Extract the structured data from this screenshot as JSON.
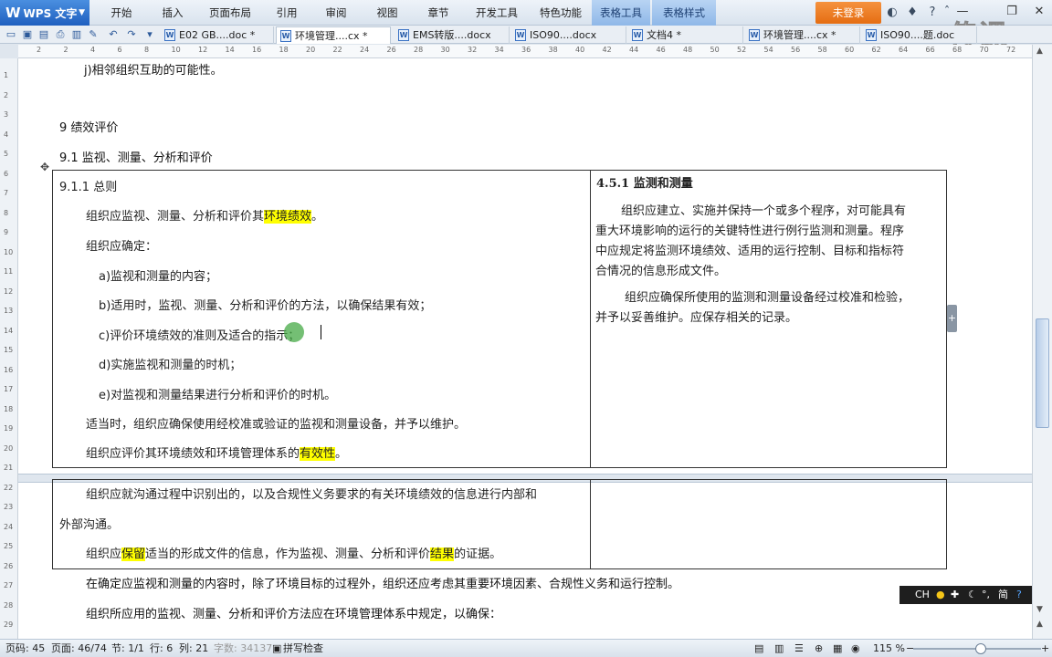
{
  "app": {
    "logo": "WPS 文字"
  },
  "menu": [
    "开始",
    "插入",
    "页面布局",
    "引用",
    "审阅",
    "视图",
    "章节",
    "开发工具",
    "特色功能",
    "表格工具",
    "表格样式"
  ],
  "login": "未登录",
  "watermark": "传课",
  "doc_tabs": [
    {
      "label": "E02 GB....doc *"
    },
    {
      "label": "环境管理....cx *"
    },
    {
      "label": "EMS转版....docx"
    },
    {
      "label": "ISO90....docx"
    },
    {
      "label": "文档4 *"
    },
    {
      "label": "环境管理....cx *"
    },
    {
      "label": "ISO90....题.doc"
    }
  ],
  "hruler_numbers": [
    "2",
    "2",
    "4",
    "6",
    "8",
    "10",
    "12",
    "14",
    "16",
    "18",
    "20",
    "22",
    "24",
    "26",
    "28",
    "30",
    "32",
    "34",
    "36",
    "38",
    "40",
    "42",
    "44",
    "46",
    "48",
    "50",
    "52",
    "54",
    "56",
    "58",
    "60",
    "62",
    "64",
    "66",
    "68",
    "70",
    "72"
  ],
  "vruler_numbers": [
    "1",
    "2",
    "3",
    "4",
    "5",
    "6",
    "7",
    "8",
    "9",
    "10",
    "11",
    "12",
    "13",
    "14",
    "15",
    "16",
    "17",
    "18",
    "19",
    "20",
    "21",
    "22",
    "23",
    "24",
    "25",
    "26",
    "27",
    "28",
    "29"
  ],
  "document": {
    "top_fragment": "j)相邻组织互助的可能性。",
    "heading_9": "9 绩效评价",
    "heading_91": "9.1 监视、测量、分析和评价",
    "left": {
      "h": "9.1.1 总则",
      "p1a": "组织应监视、测量、分析和评价其",
      "p1hl": "环境绩效",
      "p1b": "。",
      "p2": "组织应确定：",
      "a": "a)监视和测量的内容；",
      "b": "b)适用时，监视、测量、分析和评价的方法，以确保结果有效；",
      "c": "c)评价环境绩效的准则及适合的指示；",
      "d": "d)实施监视和测量的时机；",
      "e": "e)对监视和测量结果进行分析和评价的时机。",
      "p3": "适当时，组织应确保使用经校准或验证的监视和测量设备，并予以维护。",
      "p4a": "组织应评价其环境绩效和环境管理体系的",
      "p4hl": "有效性",
      "p4b": "。"
    },
    "right": {
      "h": "4.5.1 监测和测量",
      "l1": "组织应建立、实施并保持一个或多个程序，对可能具有",
      "l2": "重大环境影响的运行的关键特性进行例行监测和测量。程序",
      "l3": "中应规定将监测环境绩效、适用的运行控制、目标和指标符",
      "l4": "合情况的信息形成文件。",
      "l5": "组织应确保所使用的监测和测量设备经过校准和检验，",
      "l6": "并予以妥善维护。应保存相关的记录。"
    },
    "lower": {
      "l1": "组织应就沟通过程中识别出的，以及合规性义务要求的有关环境绩效的信息进行内部和",
      "l2": "外部沟通。",
      "l3a": "组织应",
      "l3hl": "保留",
      "l3b": "适当的形成文件的信息，作为监视、测量、分析和评价",
      "l3hl2": "结果",
      "l3c": "的证据。"
    },
    "after1": "在确定应监视和测量的内容时，除了环境目标的过程外，组织还应考虑其重要环境因素、合规性义务和运行控制。",
    "after2": "组织所应用的监视、测量、分析和评价方法应在环境管理体系中规定，以确保："
  },
  "ime": {
    "lang": "CH",
    "mode": "简"
  },
  "status": {
    "page_code": "页码: 45",
    "page": "页面: 46/74",
    "section": "节: 1/1",
    "row": "行: 6",
    "col": "列: 21",
    "words": "字数: 34137",
    "spell": "拼写检查",
    "zoom": "115 %"
  },
  "colors": {
    "highlight": "#ffff00",
    "accent": "#1f5fbf",
    "login": "#e56d12"
  }
}
